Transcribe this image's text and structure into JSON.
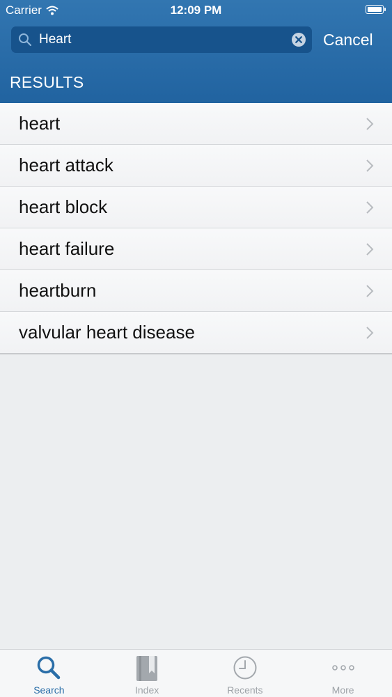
{
  "status_bar": {
    "carrier": "Carrier",
    "time": "12:09 PM"
  },
  "search": {
    "value": "Heart",
    "cancel_label": "Cancel"
  },
  "section_label": "RESULTS",
  "results": [
    {
      "label": "heart"
    },
    {
      "label": "heart attack"
    },
    {
      "label": "heart block"
    },
    {
      "label": "heart failure"
    },
    {
      "label": "heartburn"
    },
    {
      "label": "valvular heart disease"
    }
  ],
  "tabs": [
    {
      "label": "Search",
      "icon": "search-icon",
      "active": true
    },
    {
      "label": "Index",
      "icon": "book-icon",
      "active": false
    },
    {
      "label": "Recents",
      "icon": "clock-icon",
      "active": false
    },
    {
      "label": "More",
      "icon": "more-dots-icon",
      "active": false
    }
  ],
  "colors": {
    "header": "#2a6ea8",
    "active_tab": "#2a6ea8",
    "inactive_tab": "#9ea3a8"
  }
}
